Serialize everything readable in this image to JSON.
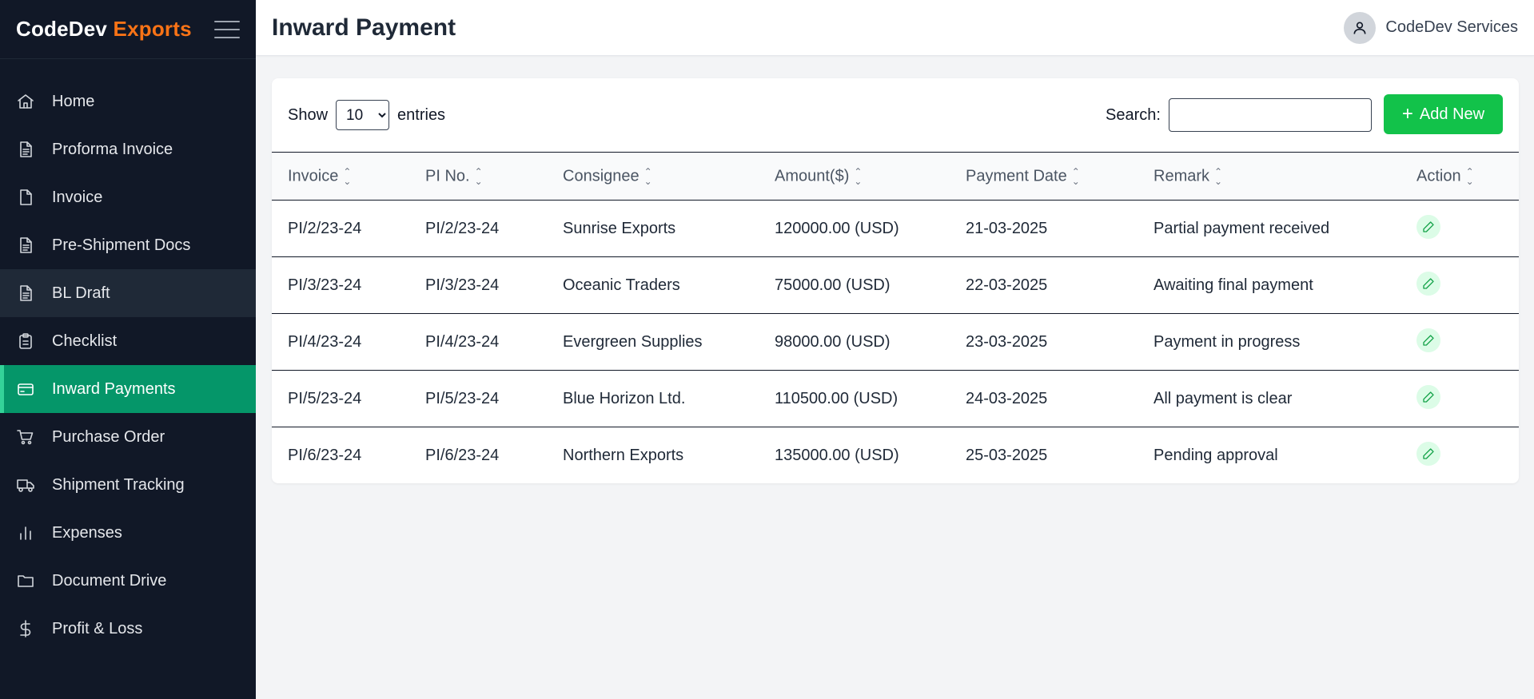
{
  "brand": {
    "part1": "CodeDev",
    "part2": "Exports"
  },
  "sidebar": {
    "items": [
      {
        "label": "Home",
        "icon": "home-icon"
      },
      {
        "label": "Proforma Invoice",
        "icon": "document-text-icon"
      },
      {
        "label": "Invoice",
        "icon": "document-icon"
      },
      {
        "label": "Pre-Shipment Docs",
        "icon": "document-text-icon"
      },
      {
        "label": "BL Draft",
        "icon": "document-text-icon"
      },
      {
        "label": "Checklist",
        "icon": "clipboard-icon"
      },
      {
        "label": "Inward Payments",
        "icon": "credit-card-icon"
      },
      {
        "label": "Purchase Order",
        "icon": "shopping-cart-icon"
      },
      {
        "label": "Shipment Tracking",
        "icon": "truck-icon"
      },
      {
        "label": "Expenses",
        "icon": "bar-chart-icon"
      },
      {
        "label": "Document Drive",
        "icon": "folder-icon"
      },
      {
        "label": "Profit & Loss",
        "icon": "dollar-icon"
      }
    ]
  },
  "header": {
    "title": "Inward Payment",
    "user_name": "CodeDev Services"
  },
  "controls": {
    "show_label": "Show",
    "entries_value": "10",
    "entries_label": "entries",
    "search_label": "Search:",
    "search_value": "",
    "add_button": "Add New"
  },
  "table": {
    "columns": [
      "Invoice",
      "PI No.",
      "Consignee",
      "Amount($)",
      "Payment Date",
      "Remark",
      "Action"
    ],
    "rows": [
      [
        "PI/2/23-24",
        "PI/2/23-24",
        "Sunrise Exports",
        "120000.00 (USD)",
        "21-03-2025",
        "Partial payment received"
      ],
      [
        "PI/3/23-24",
        "PI/3/23-24",
        "Oceanic Traders",
        "75000.00 (USD)",
        "22-03-2025",
        "Awaiting final payment"
      ],
      [
        "PI/4/23-24",
        "PI/4/23-24",
        "Evergreen Supplies",
        "98000.00 (USD)",
        "23-03-2025",
        "Payment in progress"
      ],
      [
        "PI/5/23-24",
        "PI/5/23-24",
        "Blue Horizon Ltd.",
        "110500.00 (USD)",
        "24-03-2025",
        "All payment is clear"
      ],
      [
        "PI/6/23-24",
        "PI/6/23-24",
        "Northern Exports",
        "135000.00 (USD)",
        "25-03-2025",
        "Pending approval"
      ]
    ]
  },
  "colors": {
    "sidebar_bg": "#111827",
    "brand_accent": "#f97316",
    "active_nav": "#059669",
    "add_button": "#12c24a",
    "edit_icon": "#16a34a"
  }
}
